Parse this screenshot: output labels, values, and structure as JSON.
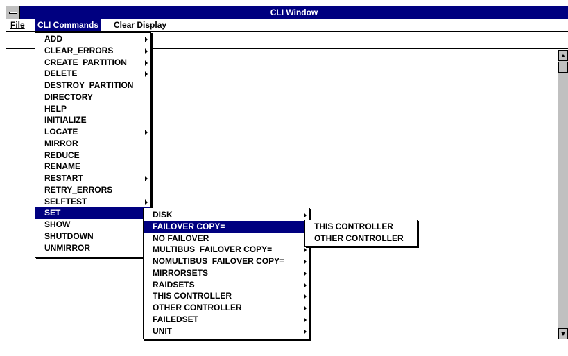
{
  "window": {
    "title": "CLI Window"
  },
  "menubar": {
    "file": "File",
    "cli_commands": "CLI Commands",
    "clear_display": "Clear Display"
  },
  "cli_menu": {
    "items": [
      {
        "label": "ADD",
        "submenu": true
      },
      {
        "label": "CLEAR_ERRORS",
        "submenu": true
      },
      {
        "label": "CREATE_PARTITION",
        "submenu": true
      },
      {
        "label": "DELETE",
        "submenu": true
      },
      {
        "label": "DESTROY_PARTITION",
        "submenu": false
      },
      {
        "label": "DIRECTORY",
        "submenu": false
      },
      {
        "label": "HELP",
        "submenu": false
      },
      {
        "label": "INITIALIZE",
        "submenu": false
      },
      {
        "label": "LOCATE",
        "submenu": true
      },
      {
        "label": "MIRROR",
        "submenu": false
      },
      {
        "label": "REDUCE",
        "submenu": false
      },
      {
        "label": "RENAME",
        "submenu": false
      },
      {
        "label": "RESTART",
        "submenu": true
      },
      {
        "label": "RETRY_ERRORS",
        "submenu": false
      },
      {
        "label": "SELFTEST",
        "submenu": true
      },
      {
        "label": "SET",
        "submenu": true,
        "selected": true
      },
      {
        "label": "SHOW",
        "submenu": true
      },
      {
        "label": "SHUTDOWN",
        "submenu": false
      },
      {
        "label": "UNMIRROR",
        "submenu": false
      }
    ]
  },
  "set_menu": {
    "items": [
      {
        "label": "DISK",
        "submenu": true
      },
      {
        "label": "FAILOVER COPY=",
        "submenu": true,
        "selected": true
      },
      {
        "label": "NO FAILOVER",
        "submenu": false
      },
      {
        "label": "MULTIBUS_FAILOVER COPY=",
        "submenu": true
      },
      {
        "label": "NOMULTIBUS_FAILOVER COPY=",
        "submenu": true
      },
      {
        "label": "MIRRORSETS",
        "submenu": true
      },
      {
        "label": "RAIDSETS",
        "submenu": true
      },
      {
        "label": "THIS CONTROLLER",
        "submenu": true
      },
      {
        "label": "OTHER CONTROLLER",
        "submenu": true
      },
      {
        "label": "FAILEDSET",
        "submenu": true
      },
      {
        "label": "UNIT",
        "submenu": true
      }
    ]
  },
  "failover_menu": {
    "items": [
      {
        "label": "THIS CONTROLLER"
      },
      {
        "label": "OTHER CONTROLLER"
      }
    ]
  },
  "command_input": {
    "value": ""
  },
  "colors": {
    "titlebar": "#000080",
    "selection": "#000080",
    "scrollbar": "#c0c0c0"
  }
}
